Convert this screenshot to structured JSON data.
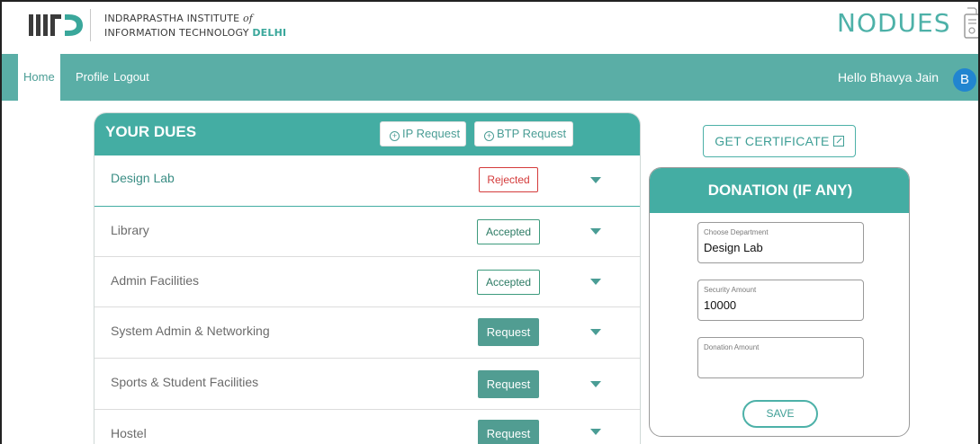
{
  "header": {
    "institute_line1": "INDRAPRASTHA INSTITUTE",
    "institute_of": "of",
    "institute_line2": "INFORMATION TECHNOLOGY",
    "institute_delhi": "DELHI",
    "brand": "NODUES"
  },
  "nav": {
    "items": [
      {
        "label": "Home"
      },
      {
        "label": "Profile"
      },
      {
        "label": "Logout"
      }
    ],
    "greeting": "Hello Bhavya Jain",
    "avatar_initial": "B"
  },
  "dues": {
    "title": "YOUR DUES",
    "ip_request": "IP Request",
    "btp_request": "BTP Request",
    "rows": [
      {
        "name": "Design Lab",
        "status": "Rejected"
      },
      {
        "name": "Library",
        "status": "Accepted"
      },
      {
        "name": "Admin Facilities",
        "status": "Accepted"
      },
      {
        "name": "System Admin & Networking",
        "status": "Request"
      },
      {
        "name": "Sports & Student Facilities",
        "status": "Request"
      },
      {
        "name": "Hostel",
        "status": "Request"
      }
    ]
  },
  "certificate": {
    "label": "GET CERTIFICATE"
  },
  "donation": {
    "title": "DONATION (IF ANY)",
    "department_label": "Choose Department",
    "department_value": "Design Lab",
    "security_label": "Security Amount",
    "security_value": "10000",
    "donation_label": "Donation Amount",
    "donation_value": "",
    "save_label": "SAVE"
  },
  "colors": {
    "teal": "#44ada3",
    "nav": "#5aaea6",
    "rejected": "#d43b3b",
    "accepted": "#2b7a63",
    "request": "#519d92",
    "avatar": "#2185d0"
  }
}
